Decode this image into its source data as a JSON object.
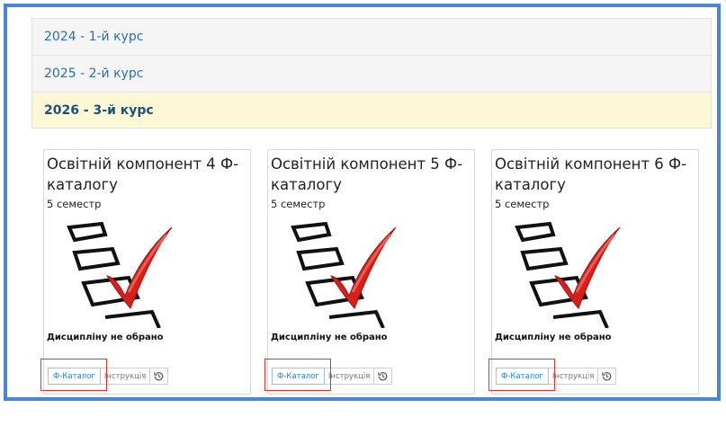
{
  "accordion": [
    {
      "label": "2024 - 1-й курс"
    },
    {
      "label": "2025 - 2-й курс"
    },
    {
      "label": "2026 - 3-й курс"
    }
  ],
  "cards": [
    {
      "title": "Освітній компонент 4 Ф-каталогу",
      "semester": "5 семестр",
      "status": "Дисципліну не обрано",
      "catalog_button": "Ф-Каталог",
      "instruction_button": "Інструкція",
      "history_icon": "history-icon"
    },
    {
      "title": "Освітній компонент 5 Ф-каталогу",
      "semester": "5 семестр",
      "status": "Дисципліну не обрано",
      "catalog_button": "Ф-Каталог",
      "instruction_button": "Інструкція",
      "history_icon": "history-icon"
    },
    {
      "title": "Освітній компонент 6 Ф-каталогу",
      "semester": "5 семестр",
      "status": "Дисципліну не обрано",
      "catalog_button": "Ф-Каталог",
      "instruction_button": "Інструкція",
      "history_icon": "history-icon"
    }
  ],
  "colors": {
    "frame_border": "#4a86d8",
    "link": "#2a6fb0",
    "active_bg": "#fcf8d6",
    "highlight": "#e03030",
    "check": "#d8201a"
  }
}
